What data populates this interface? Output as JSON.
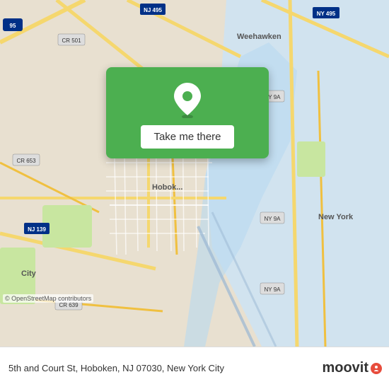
{
  "map": {
    "alt": "Map of Hoboken NJ area"
  },
  "card": {
    "button_label": "Take me there"
  },
  "bottom_bar": {
    "address": "5th and Court St, Hoboken, NJ 07030, New York City",
    "osm_credit": "© OpenStreetMap contributors",
    "logo_text": "moovit"
  }
}
